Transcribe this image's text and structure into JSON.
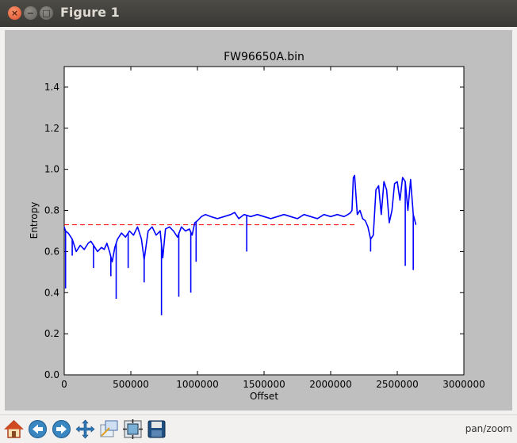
{
  "window": {
    "title": "Figure 1"
  },
  "toolbar": {
    "buttons": [
      {
        "name": "home-button",
        "icon": "home-icon"
      },
      {
        "name": "back-button",
        "icon": "arrow-left-icon"
      },
      {
        "name": "forward-button",
        "icon": "arrow-right-icon"
      },
      {
        "name": "pan-button",
        "icon": "move-arrows-icon"
      },
      {
        "name": "zoom-button",
        "icon": "zoom-rect-icon"
      },
      {
        "name": "subplots-button",
        "icon": "subplots-icon"
      },
      {
        "name": "save-button",
        "icon": "floppy-disk-icon"
      }
    ],
    "mode_label": "pan/zoom"
  },
  "chart_data": {
    "type": "line",
    "title": "FW96650A.bin",
    "xlabel": "Offset",
    "ylabel": "Entropy",
    "xlim": [
      0,
      3000000
    ],
    "ylim": [
      0.0,
      1.5
    ],
    "xticks": [
      "0",
      "500000",
      "1000000",
      "1500000",
      "2000000",
      "2500000",
      "3000000"
    ],
    "yticks": [
      "0.0",
      "0.2",
      "0.4",
      "0.6",
      "0.8",
      "1.0",
      "1.2",
      "1.4"
    ],
    "grid": false,
    "colors": {
      "series": "#0000ff",
      "threshold": "#ff0000"
    },
    "threshold": {
      "y": 0.73,
      "x_range": [
        0,
        2200000
      ],
      "style": "dashed"
    },
    "series": [
      {
        "x": [
          0,
          10000,
          30000,
          60000,
          90000,
          120000,
          150000,
          180000,
          200000,
          220000,
          250000,
          280000,
          300000,
          320000,
          340000,
          360000,
          380000,
          400000,
          430000,
          460000,
          490000,
          520000,
          550000,
          580000,
          600000,
          630000,
          660000,
          690000,
          720000,
          740000,
          760000,
          790000,
          820000,
          850000,
          880000,
          910000,
          940000,
          960000,
          980000,
          1000000,
          1030000,
          1060000,
          1100000,
          1150000,
          1200000,
          1250000,
          1280000,
          1310000,
          1350000,
          1400000,
          1450000,
          1500000,
          1550000,
          1600000,
          1650000,
          1700000,
          1750000,
          1800000,
          1850000,
          1900000,
          1950000,
          2000000,
          2050000,
          2100000,
          2130000,
          2150000,
          2160000,
          2170000,
          2180000,
          2200000,
          2220000,
          2240000,
          2260000,
          2280000,
          2300000,
          2320000,
          2340000,
          2360000,
          2380000,
          2400000,
          2420000,
          2440000,
          2460000,
          2480000,
          2500000,
          2520000,
          2540000,
          2560000,
          2580000,
          2600000,
          2620000,
          2640000
        ],
        "y": [
          0.72,
          0.7,
          0.69,
          0.66,
          0.6,
          0.63,
          0.61,
          0.64,
          0.65,
          0.63,
          0.6,
          0.62,
          0.61,
          0.64,
          0.6,
          0.55,
          0.62,
          0.66,
          0.69,
          0.67,
          0.7,
          0.68,
          0.72,
          0.66,
          0.56,
          0.7,
          0.72,
          0.68,
          0.7,
          0.57,
          0.71,
          0.72,
          0.7,
          0.67,
          0.72,
          0.7,
          0.71,
          0.68,
          0.74,
          0.75,
          0.77,
          0.78,
          0.77,
          0.76,
          0.77,
          0.78,
          0.79,
          0.76,
          0.78,
          0.77,
          0.78,
          0.77,
          0.76,
          0.77,
          0.78,
          0.77,
          0.76,
          0.78,
          0.77,
          0.76,
          0.78,
          0.77,
          0.78,
          0.77,
          0.78,
          0.79,
          0.8,
          0.96,
          0.97,
          0.78,
          0.8,
          0.76,
          0.75,
          0.72,
          0.66,
          0.68,
          0.9,
          0.92,
          0.78,
          0.94,
          0.9,
          0.74,
          0.8,
          0.93,
          0.94,
          0.85,
          0.96,
          0.94,
          0.8,
          0.95,
          0.78,
          0.73
        ]
      }
    ],
    "spikes": [
      {
        "x": 10000,
        "y": 0.42
      },
      {
        "x": 60000,
        "y": 0.58
      },
      {
        "x": 220000,
        "y": 0.52
      },
      {
        "x": 350000,
        "y": 0.48
      },
      {
        "x": 390000,
        "y": 0.37
      },
      {
        "x": 480000,
        "y": 0.52
      },
      {
        "x": 600000,
        "y": 0.45
      },
      {
        "x": 730000,
        "y": 0.29
      },
      {
        "x": 860000,
        "y": 0.38
      },
      {
        "x": 950000,
        "y": 0.4
      },
      {
        "x": 990000,
        "y": 0.55
      },
      {
        "x": 1370000,
        "y": 0.6
      },
      {
        "x": 2300000,
        "y": 0.6
      },
      {
        "x": 2560000,
        "y": 0.53
      },
      {
        "x": 2620000,
        "y": 0.51
      }
    ]
  }
}
